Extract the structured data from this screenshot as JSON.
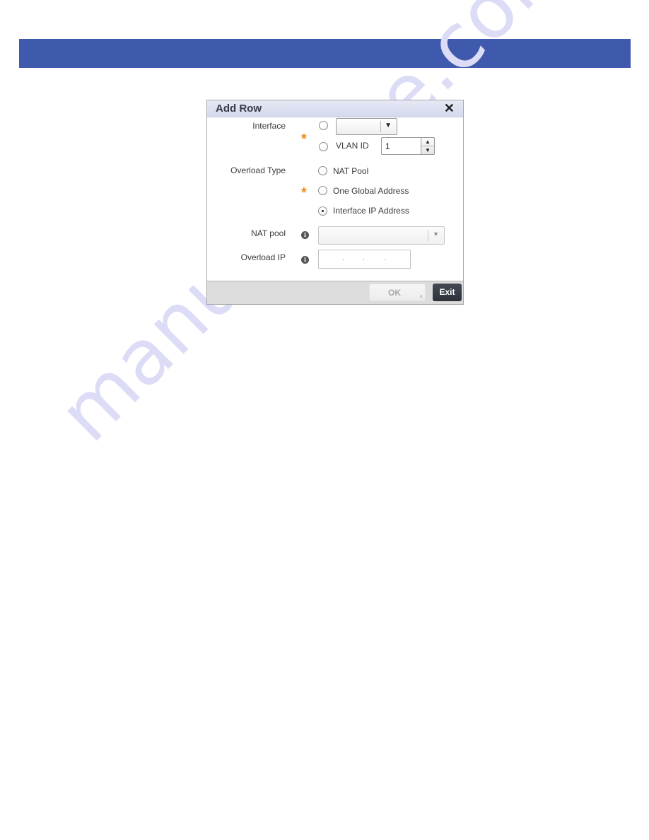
{
  "banner": {
    "color": "#3f5aad"
  },
  "watermark": {
    "text": "manualshive.com"
  },
  "dialog": {
    "title": "Add Row",
    "close_icon": "close-icon",
    "fields": {
      "interface": {
        "label": "Interface",
        "required": true,
        "required_marker": "*",
        "options": [
          {
            "type": "select",
            "selected": false,
            "value": ""
          },
          {
            "type": "vlan",
            "selected": false,
            "label": "VLAN ID",
            "value": "1"
          }
        ],
        "dropdown_icon": "▼",
        "spinner_up_icon": "▲",
        "spinner_down_icon": "▼"
      },
      "overload_type": {
        "label": "Overload Type",
        "required": true,
        "required_marker": "*",
        "options": [
          {
            "label": "NAT Pool",
            "selected": false
          },
          {
            "label": "One Global Address",
            "selected": false
          },
          {
            "label": "Interface IP Address",
            "selected": true
          }
        ]
      },
      "nat_pool": {
        "label": "NAT pool",
        "info_icon": "i",
        "value": "",
        "dropdown_icon": "▼",
        "enabled": false
      },
      "overload_ip": {
        "label": "Overload IP",
        "info_icon": "i",
        "value": "",
        "placeholder_dots": [
          ".",
          ".",
          "."
        ]
      }
    },
    "buttons": {
      "ok_label": "OK",
      "ok_enabled": false,
      "ok_error_mark": "×",
      "exit_label": "Exit"
    },
    "colors": {
      "required": "#f08a1c",
      "header_bg": "#d9dcef",
      "exit_bg": "#343943"
    }
  }
}
